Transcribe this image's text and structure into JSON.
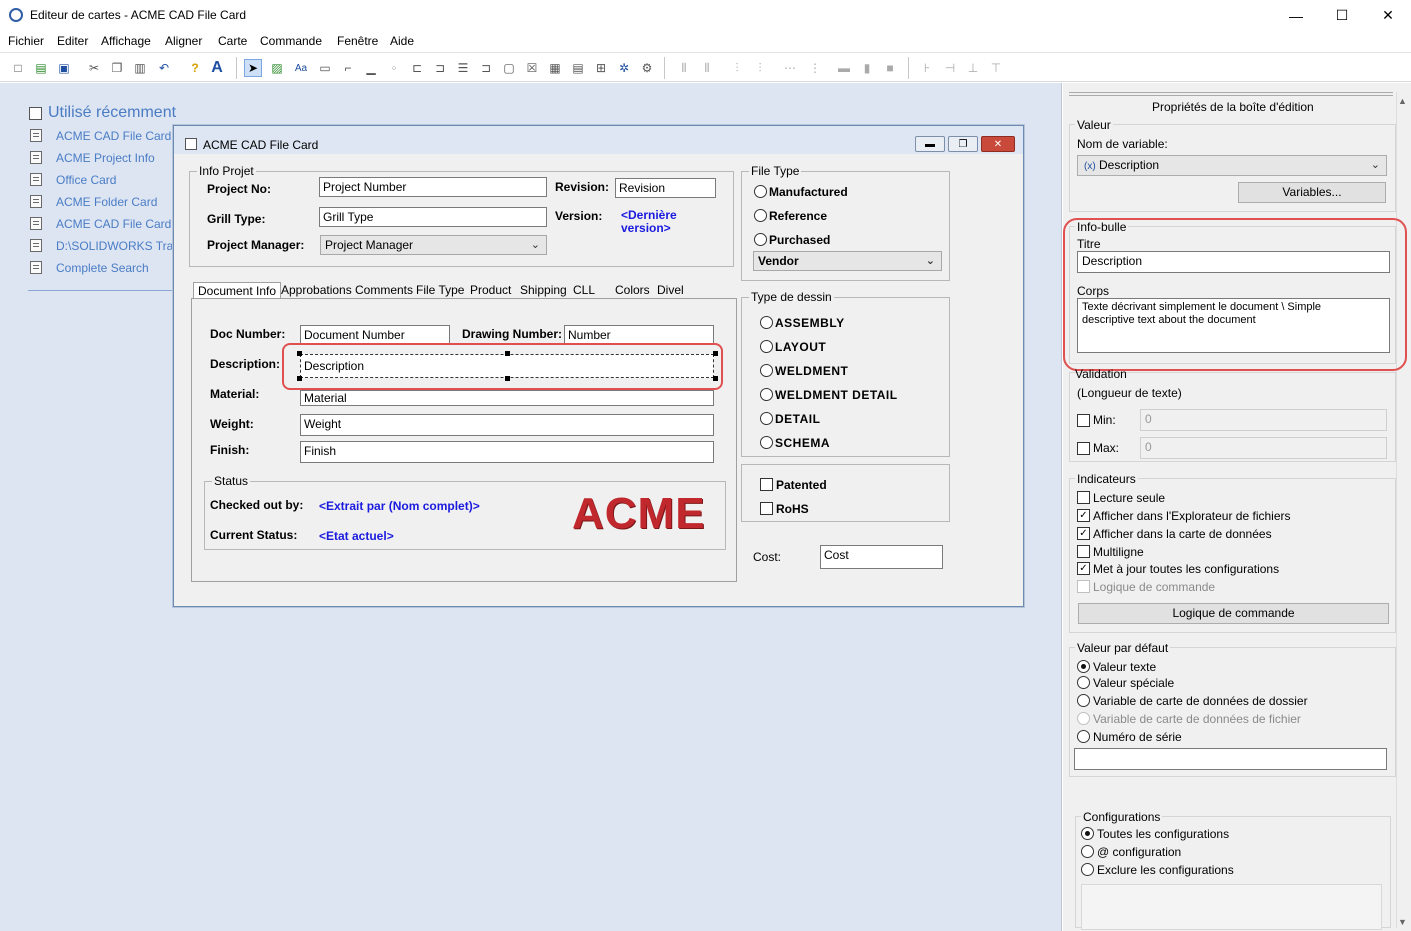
{
  "window": {
    "title": "Editeur de cartes - ACME CAD File Card",
    "minimize": "—",
    "maximize": "☐",
    "close": "✕"
  },
  "menu": [
    "Fichier",
    "Editer",
    "Affichage",
    "Aligner",
    "Carte",
    "Commande",
    "Fenêtre",
    "Aide"
  ],
  "recent": {
    "title": "Utilisé récemment",
    "items": [
      "ACME CAD File Card",
      "ACME Project Info",
      "Office Card",
      "ACME Folder Card",
      "ACME CAD File Card -",
      "D:\\SOLIDWORKS Train",
      "Complete Search"
    ]
  },
  "card": {
    "title": "ACME CAD File Card",
    "info_projet": {
      "group": "Info Projet",
      "project_no_label": "Project No:",
      "project_no_value": "Project Number",
      "revision_label": "Revision:",
      "revision_value": "Revision",
      "grill_type_label": "Grill Type:",
      "grill_type_value": "Grill Type",
      "version_label": "Version:",
      "version_value": "<Dernière version>",
      "pm_label": "Project Manager:",
      "pm_value": "Project Manager"
    },
    "file_type": {
      "group": "File Type",
      "options": [
        "Manufactured",
        "Reference",
        "Purchased"
      ],
      "vendor": "Vendor"
    },
    "tabs": [
      "Document Info",
      "Approbations",
      "Comments",
      "File Type",
      "Product",
      "Shipping",
      "CLL",
      "Colors",
      "Divel"
    ],
    "doc": {
      "doc_number_label": "Doc Number:",
      "doc_number_value": "Document Number",
      "drawing_number_label": "Drawing Number:",
      "drawing_number_value": "Number",
      "description_label": "Description:",
      "description_value": "Description",
      "material_label": "Material:",
      "material_value": "Material",
      "weight_label": "Weight:",
      "weight_value": "Weight",
      "finish_label": "Finish:",
      "finish_value": "Finish"
    },
    "status": {
      "group": "Status",
      "checked_out_label": "Checked out by:",
      "checked_out_value": "<Extrait par (Nom complet)>",
      "current_status_label": "Current Status:",
      "current_status_value": "<Etat actuel>",
      "logo": "ACME"
    },
    "type_dessin": {
      "group": "Type de dessin",
      "options": [
        "ASSEMBLY",
        "LAYOUT",
        "WELDMENT",
        "WELDMENT DETAIL",
        "DETAIL",
        "SCHEMA"
      ]
    },
    "checks": [
      "Patented",
      "RoHS"
    ],
    "cost_label": "Cost:",
    "cost_value": "Cost"
  },
  "panel": {
    "header": "Propriétés de la boîte d'édition",
    "valeur": "Valeur",
    "nom_variable_label": "Nom de variable:",
    "variable_value": "Description",
    "variable_icon": "(x)",
    "variables_button": "Variables...",
    "info_bulle": "Info-bulle",
    "titre_label": "Titre",
    "titre_value": "Description",
    "corps_label": "Corps",
    "corps_value": "Texte décrivant simplement le document \\ Simple descriptive text about the document",
    "validation": "Validation",
    "longueur": "(Longueur de texte)",
    "min_label": "Min:",
    "min_value": "0",
    "max_label": "Max:",
    "max_value": "0",
    "indicateurs": "Indicateurs",
    "flags": [
      {
        "label": "Lecture seule",
        "checked": false,
        "disabled": false
      },
      {
        "label": "Afficher dans l'Explorateur de fichiers",
        "checked": true,
        "disabled": false
      },
      {
        "label": "Afficher dans la carte de données",
        "checked": true,
        "disabled": false
      },
      {
        "label": "Multiligne",
        "checked": false,
        "disabled": false
      },
      {
        "label": "Met à jour toutes les configurations",
        "checked": true,
        "disabled": false
      },
      {
        "label": "Logique de commande",
        "checked": false,
        "disabled": true
      }
    ],
    "logique_button": "Logique de commande",
    "valeur_defaut": "Valeur par défaut",
    "defaults": [
      {
        "label": "Valeur texte",
        "selected": true,
        "disabled": false
      },
      {
        "label": "Valeur spéciale",
        "selected": false,
        "disabled": false
      },
      {
        "label": "Variable de carte de données de dossier",
        "selected": false,
        "disabled": false
      },
      {
        "label": "Variable de carte de données de fichier",
        "selected": false,
        "disabled": true
      },
      {
        "label": "Numéro de série",
        "selected": false,
        "disabled": false
      }
    ],
    "configurations": "Configurations",
    "configs": [
      {
        "label": "Toutes les configurations",
        "selected": true
      },
      {
        "label": "@ configuration",
        "selected": false
      },
      {
        "label": "Exclure les configurations",
        "selected": false
      }
    ]
  },
  "colors": {
    "workspace": "#dde5f3",
    "link": "#4a7cc4",
    "highlight": "#e05050",
    "logo": "#c0282d"
  }
}
